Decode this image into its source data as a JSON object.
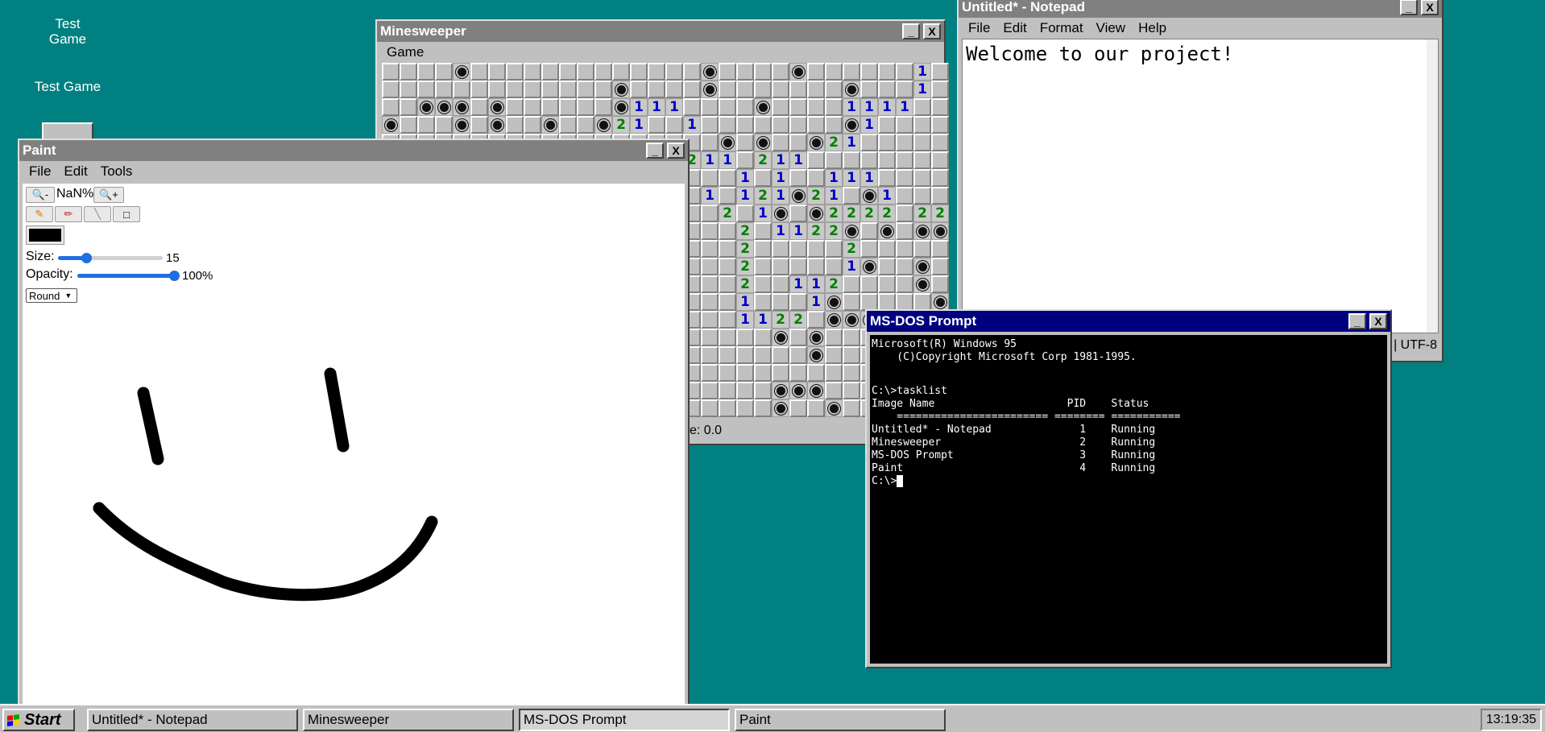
{
  "desktop": {
    "icon_alt": "Test Game",
    "icon_label": "Test Game"
  },
  "minesweeper": {
    "title": "Minesweeper",
    "menu": [
      "Game"
    ],
    "status_fragment": "e: 0.0",
    "colors": {
      "one": "#0000c8",
      "two": "#008000",
      "exploded": "#e00000"
    },
    "rows": [
      "????M?????????????M????M??????1?",
      "?????????????M????M???????M???1?",
      "??MMM?M??????M111????M????1111??",
      "M???M?M??M??M21??1????????M1????",
      "???????????????????M?M??M21?????",
      "????????????????2211?211????????",
      "????????????????????1?1??111????",
      "??????????????????1?121M21?M1???",
      "???????????????????2?1M?M2222?2222",
      "????????????????????2?1122M?M?MM",
      "????????????????????2?????2?????",
      "????????????????????2?????1M??M?",
      "????????????????????2??112????M?",
      "????????????????????1???1M?????M",
      "????????????????????1122?MMMMM??",
      "??????????????????????M?M???????",
      "????????????????????????M???????",
      "????????????????????????????????",
      "??????????????????????MMM??????M",
      "??????????????????????M??M?????M"
    ],
    "exploded_row": 3,
    "exploded_col": 8
  },
  "paint": {
    "title": "Paint",
    "menu": [
      "File",
      "Edit",
      "Tools"
    ],
    "zoom_out_label": "🔍-",
    "zoom_value": "NaN%",
    "zoom_in_label": "🔍+",
    "size_label": "Size:",
    "size_value": "15",
    "size_level": 0.25,
    "opacity_label": "Opacity:",
    "opacity_value": "100%",
    "opacity_level": 1.0,
    "brush_shape": "Round",
    "brush_color": "#000000"
  },
  "notepad": {
    "title": "Untitled* - Notepad",
    "menu": [
      "File",
      "Edit",
      "Format",
      "View",
      "Help"
    ],
    "content": "Welcome to our project!",
    "status_encoding": "| UTF-8"
  },
  "dos": {
    "title": "MS-DOS Prompt",
    "lines": [
      "Microsoft(R) Windows 95",
      "    (C)Copyright Microsoft Corp 1981-1995.",
      "",
      "",
      "C:\\>tasklist",
      "Image Name                     PID    Status",
      "    ======================== ======== ===========",
      "Untitled* - Notepad              1    Running",
      "Minesweeper                      2    Running",
      "MS-DOS Prompt                    3    Running",
      "Paint                            4    Running"
    ],
    "prompt": "C:\\>"
  },
  "taskbar": {
    "start_label": "Start",
    "items": [
      "Untitled* - Notepad",
      "Minesweeper",
      "MS-DOS Prompt",
      "Paint"
    ],
    "active_index": 2,
    "clock": "13:19:35"
  },
  "titlebar_buttons": {
    "minimize": "_",
    "close": "X"
  }
}
